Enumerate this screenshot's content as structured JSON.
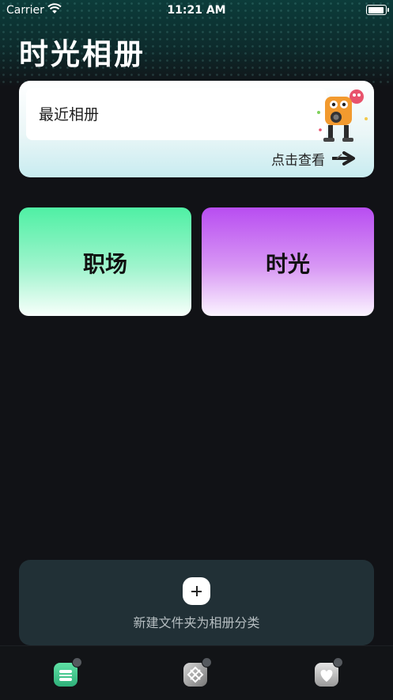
{
  "status_bar": {
    "carrier": "Carrier",
    "time": "11:21 AM"
  },
  "page_title": "时光相册",
  "recent_album": {
    "label": "最近相册",
    "view_label": "点击查看"
  },
  "tiles": [
    {
      "label": "职场",
      "color": "#4ff0a4"
    },
    {
      "label": "时光",
      "color": "#b84df1"
    }
  ],
  "new_folder": {
    "label": "新建文件夹为相册分类"
  },
  "tab_bar": {
    "icons": [
      "album-tab-icon",
      "gallery-tab-icon",
      "favorites-tab-icon"
    ]
  }
}
